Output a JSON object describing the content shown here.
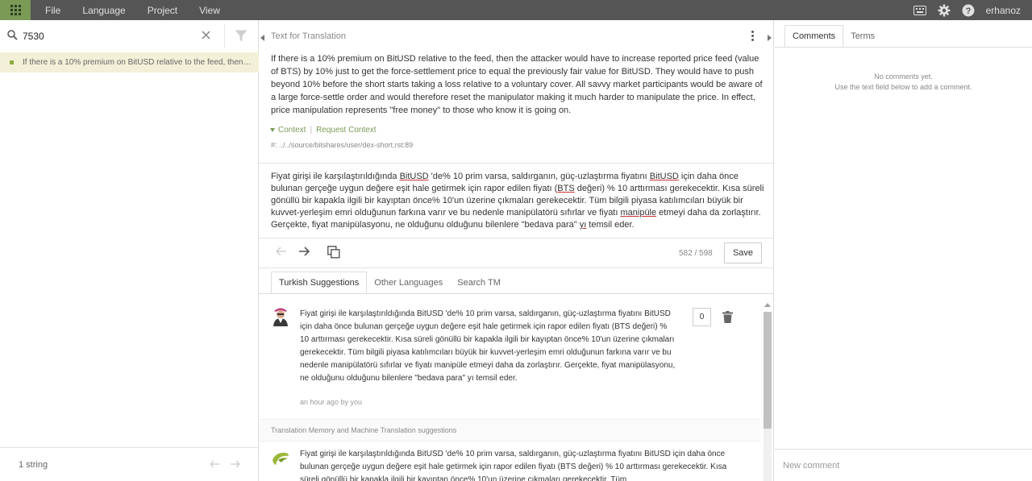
{
  "menu": {
    "items": [
      "File",
      "Language",
      "Project",
      "View"
    ],
    "username": "erhanoz"
  },
  "search": {
    "value": "7530"
  },
  "units": [
    {
      "text": "If there is a 10% premium on BitUSD relative to the feed, then the attacker would have to increase reported price feed (value of BTS) by 10% just to get the force-settlement price to equal the previously fair value for BitUSD."
    }
  ],
  "left_footer": {
    "count": "1 string"
  },
  "editor": {
    "header_title": "Text for Translation",
    "source": "If there is a 10% premium on BitUSD relative to the feed, then the attacker would have to increase reported price feed (value of BTS) by 10% just to get the force-settlement price to equal the previously fair value for BitUSD. They would have to push beyond 10% before the short starts taking a loss relative to a voluntary cover. All savvy market participants would be aware of a large force-settle order and would therefore reset the manipulator making it much harder to manipulate the price. In effect, price manipulation represents \"free money\" to those who know it is going on.",
    "context_label": "Context",
    "request_context_label": "Request Context",
    "location": "#: ../../source/bitshares/user/dex-short.rst:89",
    "target_parts": [
      "Fiyat girişi ile karşılaştırıldığında ",
      "BitUSD",
      " 'de% 10 prim varsa, saldırganın, güç-uzlaştırma fiyatını ",
      "BitUSD",
      " için daha önce bulunan gerçeğe uygun değere eşit hale getirmek için rapor edilen fiyatı (",
      "BTS",
      " değeri) % 10 arttırması gerekecektir. Kısa süreli gönüllü bir kapakla ilgili bir kayıptan önce% 10'un üzerine çıkmaları gerekecektir. Tüm bilgili piyasa katılımcıları büyük bir kuvvet-yerleşim emri olduğunun farkına varır ve bu nedenle manipülatörü sıfırlar ve fiyatı ",
      "manipüle",
      " etmeyi daha da zorlaştırır. Gerçekte, fiyat manipülasyonu, ne olduğunu olduğunu bilenlere \"bedava para\" ",
      "yı",
      " temsil eder."
    ],
    "char_count": "582 / 598",
    "save_label": "Save"
  },
  "suggestion_tabs": [
    "Turkish Suggestions",
    "Other Languages",
    "Search TM"
  ],
  "suggestions": {
    "first": {
      "text": "Fiyat girişi ile karşılaştırıldığında BitUSD 'de% 10 prim varsa, saldırganın, güç-uzlaştırma fiyatını BitUSD için daha önce bulunan gerçeğe uygun değere eşit hale getirmek için rapor edilen fiyatı (BTS değeri) % 10 arttırması gerekecektir. Kısa süreli gönüllü bir kapakla ilgili bir kayıptan önce% 10'un üzerine çıkmaları gerekecektir. Tüm bilgili piyasa katılımcıları büyük bir kuvvet-yerleşim emri olduğunun farkına varır ve bu nedenle manipülatörü sıfırlar ve fiyatı manipüle etmeyi daha da zorlaştırır. Gerçekte, fiyat manipülasyonu, ne olduğunu olduğunu bilenlere \"bedava para\" yı temsil eder.",
      "meta": "an hour ago by you",
      "votes": "0"
    },
    "tm_header": "Translation Memory and Machine Translation suggestions",
    "second": {
      "text": "Fiyat girişi ile karşılaştırıldığında BitUSD 'de% 10 prim varsa, saldırganın, güç-uzlaştırma fiyatını BitUSD için daha önce bulunan gerçeğe uygun değere eşit hale getirmek için rapor edilen fiyatı (BTS değeri) % 10 arttırması gerekecektir. Kısa süreli gönüllü bir kapakla ilgili bir kayıptan önce% 10'un üzerine çıkmaları gerekecektir. Tüm"
    }
  },
  "comments": {
    "tabs": [
      "Comments",
      "Terms"
    ],
    "empty_line1": "No comments yet.",
    "empty_line2": "Use the text field below to add a comment.",
    "new_placeholder": "New comment"
  },
  "colors": {
    "topbar": "#555555",
    "accent": "#7a9a56",
    "unit_highlight": "#f3f0d8"
  }
}
